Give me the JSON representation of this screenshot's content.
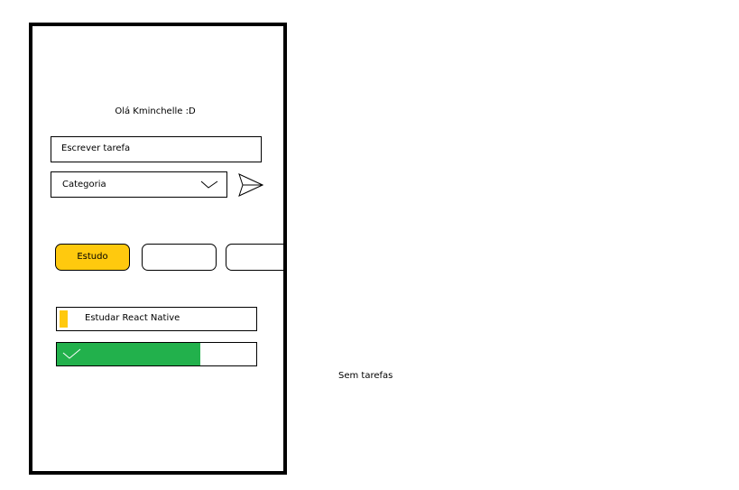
{
  "header": {
    "greeting": "Olá Kminchelle :D"
  },
  "form": {
    "task_placeholder": "Escrever tarefa",
    "category_label": "Categoria",
    "send_icon": "send-triangle-icon",
    "chevron_icon": "chevron-down-icon"
  },
  "categories": [
    {
      "label": "Estudo",
      "active": true
    },
    {
      "label": "",
      "active": false
    },
    {
      "label": "",
      "active": false
    }
  ],
  "tasks": [
    {
      "label": "Estudar React Native",
      "color": "#ffc90e"
    }
  ],
  "progress": {
    "fraction": 0.72,
    "color": "#22b14c",
    "icon": "check-icon"
  },
  "empty_state": {
    "text": "Sem tarefas"
  },
  "colors": {
    "accent": "#ffc90e",
    "success": "#22b14c"
  }
}
